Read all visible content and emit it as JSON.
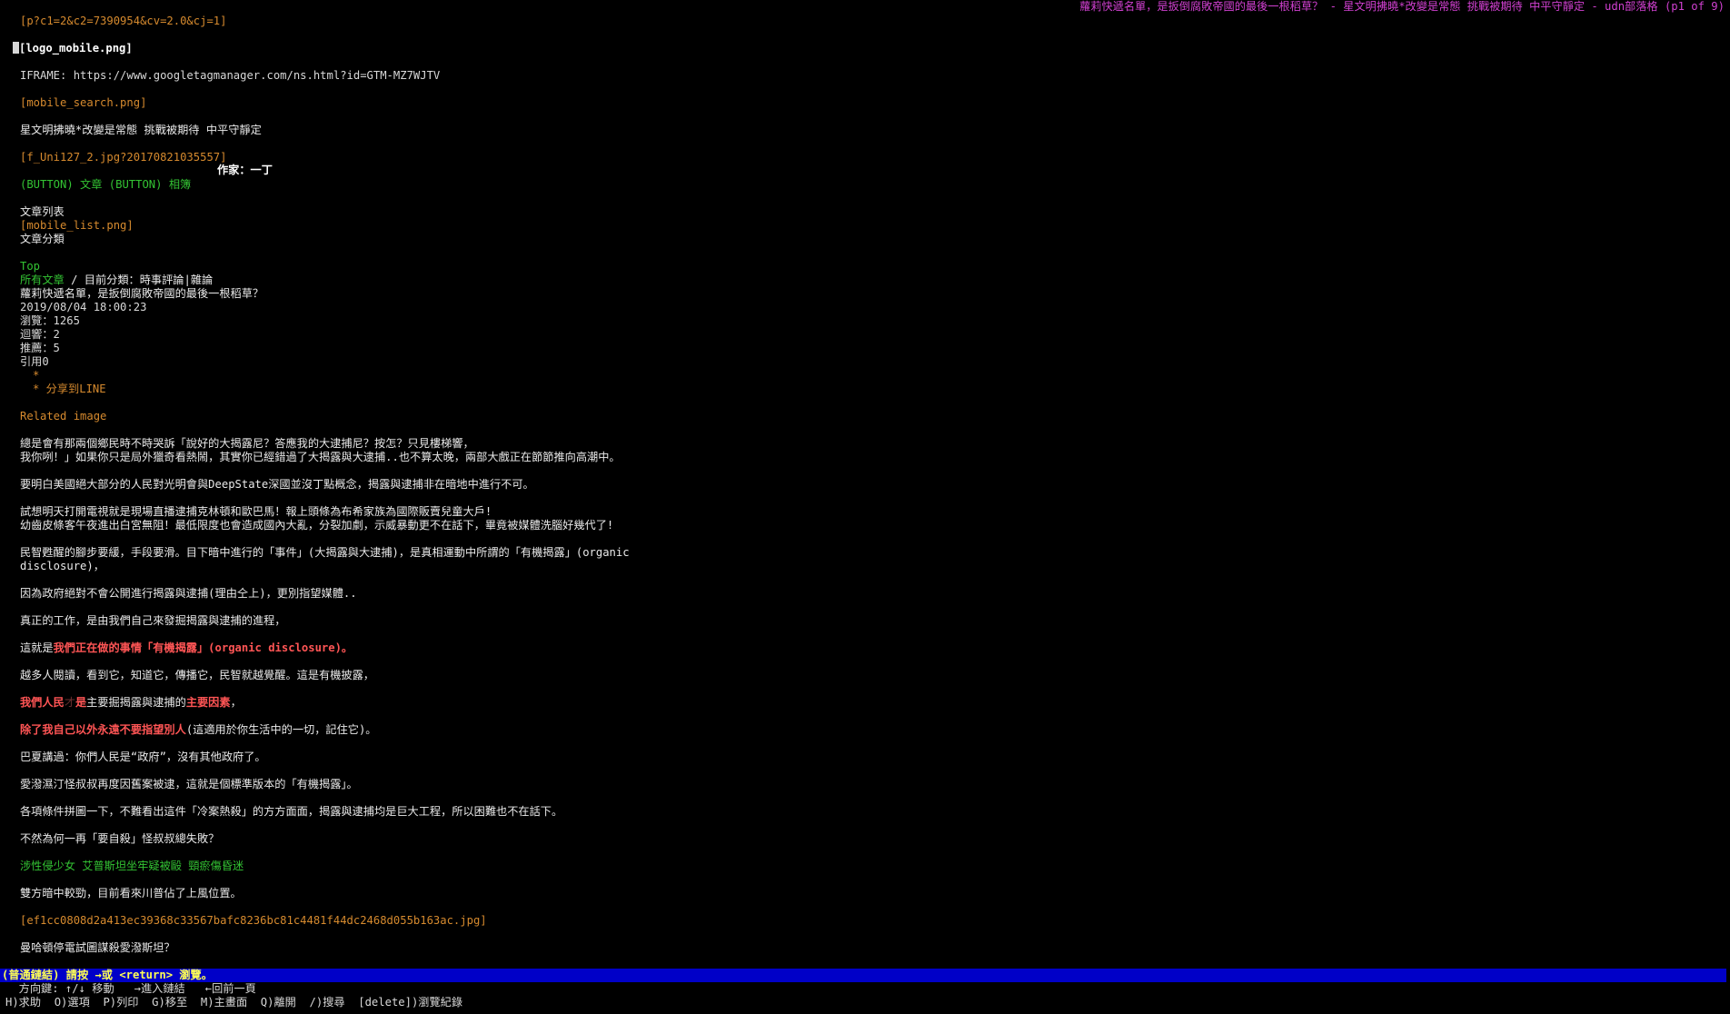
{
  "title_bar": "蘿莉快遞名單，是扳倒腐敗帝國的最後一根稻草？ - 星文明拂曉*改變是常態 挑戰被期待 中平守靜定 - udn部落格 (p1 of 9)",
  "header": {
    "tracking_pixel": "[p?c1=2&c2=7390954&cv=2.0&cj=1]",
    "logo_image": "[logo_mobile.png]",
    "iframe_line": "IFRAME: https://www.googletagmanager.com/ns.html?id=GTM-MZ7WJTV",
    "search_image": "[mobile_search.png]",
    "blog_name": "星文明拂曉*改變是常態 挑戰被期待 中平守靜定",
    "avatar_image": "[f_Uni127_2.jpg?20170821035557]",
    "author": "作家：一丁",
    "button_tag_1": "(BUTTON)",
    "link_articles": "文章",
    "button_tag_2": "(BUTTON)",
    "link_album": "相簿",
    "article_list": "文章列表",
    "list_image": "[mobile_list.png]",
    "article_category": "文章分類",
    "top_link": "Top",
    "all_articles_link": "所有文章",
    "category_text": " / 目前分類：時事評論|雜論"
  },
  "article": {
    "title": "蘿莉快遞名單，是扳倒腐敗帝國的最後一根稻草？",
    "datetime": "2019/08/04 18:00:23",
    "views": "瀏覽：1265",
    "replies": "迴響：2",
    "recommends": "推薦：5",
    "citations": "引用0",
    "bullet_empty": "*",
    "share_line": "* 分享到LINE",
    "related_image": "Related image",
    "p1_line1": "總是會有那兩個鄉民時不時哭訴「說好的大揭露尼？答應我的大逮捕尼？按怎？只見樓梯響，",
    "p1_line2": "我你咧！」如果你只是局外獵奇看熱鬧，其實你已經錯過了大揭露與大逮捕..也不算太晚，兩部大戲正在節節推向高潮中。",
    "p2": "要明白美國絕大部分的人民對光明會與DeepState深國並沒丁點概念，揭露與逮捕非在暗地中進行不可。",
    "p3_line1": "試想明天打開電視就是現場直播逮捕克林頓和歐巴馬！報上頭條為布希家族為國際販賣兒童大戶!",
    "p3_line2": "幼齒皮條客午夜進出白宮無阻！最低限度也會造成國內大亂，分裂加劇，示威暴動更不在話下，畢竟被媒體洗腦好幾代了!",
    "p4_line1": "民智甦醒的腳步要緩，手段要滑。目下暗中進行的「事件」(大揭露與大逮捕)，是真相運動中所謂的「有機揭露」(organic",
    "p4_line2": "disclosure)，",
    "p5": "因為政府絕對不會公開進行揭露與逮捕(理由仝上)，更別指望媒體..",
    "p6": "真正的工作，是由我們自己來發掘揭露與逮捕的進程，",
    "p7_prefix": "這就是",
    "p7_emph": "我們正在做的事情「有機揭露」(organic disclosure)。",
    "p8": "越多人閱讀，看到它，知道它，傳播它，民智就越覺醒。這是有機披露，",
    "p9_a": "我們人民",
    "p9_b": "才",
    "p9_c": "是",
    "p9_d": "主要掘揭露與逮捕的",
    "p9_e": "主要因素",
    "p9_f": "，",
    "p10_emph": "除了我自己以外永遠不要指望別人",
    "p10_rest": "(這適用於你生活中的一切，記住它)。",
    "p11": "巴夏講過：你們人民是“政府”，沒有其他政府了。",
    "p12": "愛潑濕汀怪叔叔再度因舊案被逮，這就是個標準版本的「有機揭露」。",
    "p13": "各項條件拼圖一下，不難看出這件「冷案熱殺」的方方面面，揭露與逮捕均是巨大工程，所以困難也不在話下。",
    "p14": "不然為何一再「要自殺」怪叔叔總失敗？",
    "link_line": "涉性侵少女 艾普斯坦坐牢疑被毆 頸瘀傷昏迷",
    "p15": "雙方暗中較勁，目前看來川普佔了上風位置。",
    "image_file": "[ef1cc0808d2a413ec39368c33567bafc8236bc81c4481f44dc2468d055b163ac.jpg]",
    "p16": "曼哈頓停電試圖謀殺愛潑斯坦？"
  },
  "status": {
    "message": "(普通鏈結) 請按 →或 <return> 瀏覽。",
    "help_line1": "  方向鍵: ↑/↓ 移動   →進入鏈結   ←回前一頁",
    "help_line2": "H)求助  O)選項  P)列印  G)移至  M)主畫面  Q)離開  /)搜尋  [delete])瀏覽紀錄"
  },
  "colors": {
    "background": "#000000",
    "text": "#d8d8d8",
    "link_orange": "#d68a2e",
    "link_green": "#33c433",
    "emphasis_red": "#ff5555",
    "title_magenta": "#d040d0",
    "status_bg": "#0000c8",
    "status_fg": "#ffff55"
  }
}
